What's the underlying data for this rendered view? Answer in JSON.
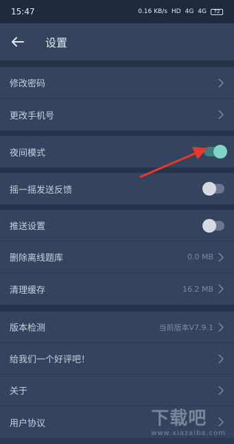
{
  "status": {
    "time": "15:47",
    "network_speed": "0.16 KB/s",
    "hd": "HD",
    "signal1": "4G",
    "signal2": "4G",
    "battery": "72"
  },
  "header": {
    "title": "设置"
  },
  "group1": [
    {
      "label": "修改密码"
    },
    {
      "label": "更改手机号"
    }
  ],
  "group2": [
    {
      "label": "夜间模式",
      "toggle_on": true
    }
  ],
  "group3": [
    {
      "label": "摇一摇发送反馈",
      "toggle_on": false
    }
  ],
  "group4": [
    {
      "label": "推送设置",
      "toggle_on": false
    },
    {
      "label": "删除离线题库",
      "value": "0.0 MB"
    },
    {
      "label": "清理缓存",
      "value": "16.2 MB"
    }
  ],
  "group5": [
    {
      "label": "版本检测",
      "value": "当前版本V7.9.1"
    },
    {
      "label": "给我们一个好评吧！"
    },
    {
      "label": "关于"
    },
    {
      "label": "用户协议"
    }
  ],
  "watermark": {
    "logo": "下载吧",
    "url": "www.xiazaiba.com"
  },
  "colors": {
    "accent": "#7fd6c8",
    "arrow": "#e8372e",
    "background": "#2b3a52"
  }
}
